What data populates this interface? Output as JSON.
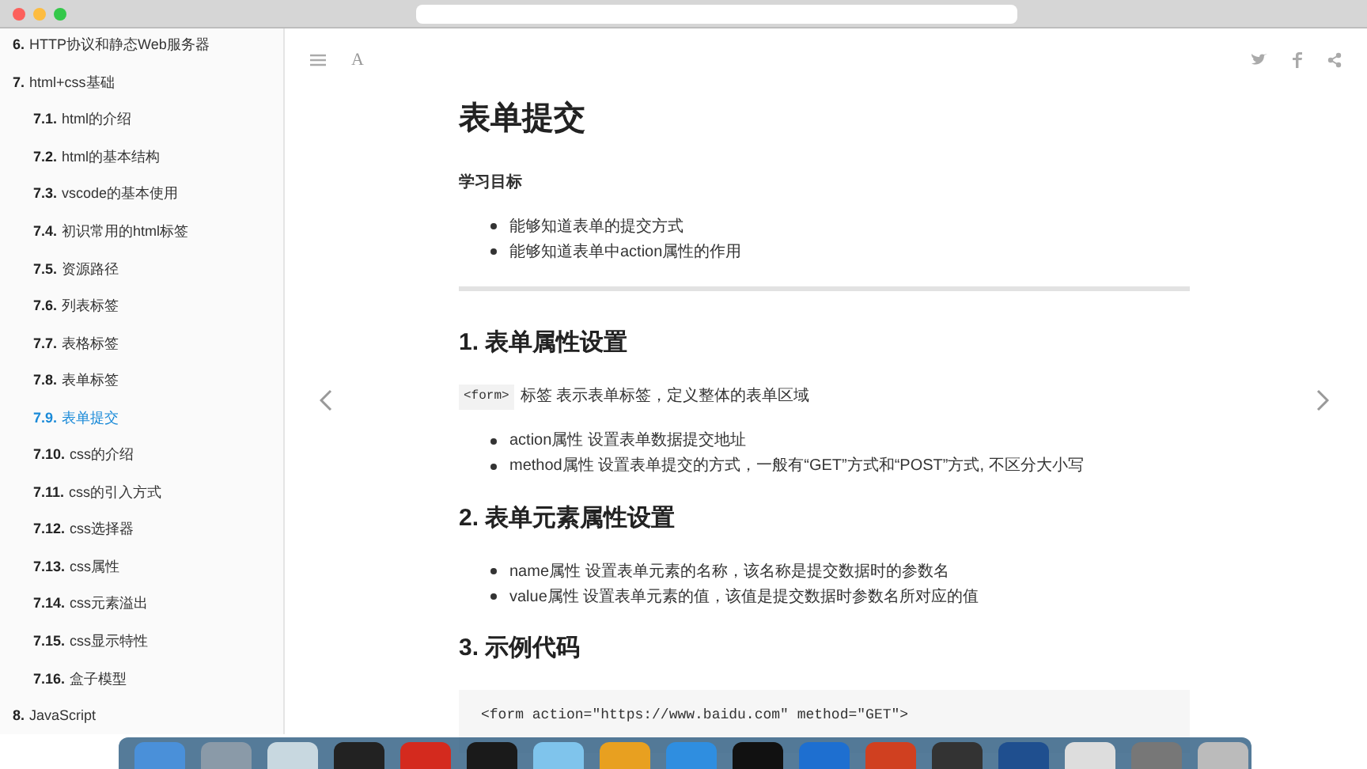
{
  "sidebar": {
    "items": [
      {
        "number": "6.",
        "label": "HTTP协议和静态Web服务器",
        "selected": false
      },
      {
        "number": "7.",
        "label": "html+css基础",
        "selected": false,
        "children": [
          {
            "number": "7.1.",
            "label": "html的介绍",
            "selected": false
          },
          {
            "number": "7.2.",
            "label": "html的基本结构",
            "selected": false
          },
          {
            "number": "7.3.",
            "label": "vscode的基本使用",
            "selected": false
          },
          {
            "number": "7.4.",
            "label": "初识常用的html标签",
            "selected": false
          },
          {
            "number": "7.5.",
            "label": "资源路径",
            "selected": false
          },
          {
            "number": "7.6.",
            "label": "列表标签",
            "selected": false
          },
          {
            "number": "7.7.",
            "label": "表格标签",
            "selected": false
          },
          {
            "number": "7.8.",
            "label": "表单标签",
            "selected": false
          },
          {
            "number": "7.9.",
            "label": "表单提交",
            "selected": true
          },
          {
            "number": "7.10.",
            "label": "css的介绍",
            "selected": false
          },
          {
            "number": "7.11.",
            "label": "css的引入方式",
            "selected": false
          },
          {
            "number": "7.12.",
            "label": "css选择器",
            "selected": false
          },
          {
            "number": "7.13.",
            "label": "css属性",
            "selected": false
          },
          {
            "number": "7.14.",
            "label": "css元素溢出",
            "selected": false
          },
          {
            "number": "7.15.",
            "label": "css显示特性",
            "selected": false
          },
          {
            "number": "7.16.",
            "label": "盒子模型",
            "selected": false
          }
        ]
      },
      {
        "number": "8.",
        "label": "JavaScript",
        "selected": false
      }
    ]
  },
  "toolbar": {
    "font_button": "A"
  },
  "article": {
    "title": "表单提交",
    "blocks": [
      {
        "kind": "strong",
        "text": "学习目标"
      },
      {
        "kind": "list",
        "items": [
          "能够知道表单的提交方式",
          "能够知道表单中action属性的作用"
        ]
      },
      {
        "kind": "rule"
      },
      {
        "kind": "heading",
        "text": "1. 表单属性设置"
      },
      {
        "kind": "para",
        "code": "<form>",
        "text": "标签 表示表单标签，定义整体的表单区域"
      },
      {
        "kind": "list",
        "items": [
          "action属性 设置表单数据提交地址",
          "method属性 设置表单提交的方式，一般有“GET”方式和“POST”方式, 不区分大小写"
        ]
      },
      {
        "kind": "heading",
        "text": "2. 表单元素属性设置"
      },
      {
        "kind": "list",
        "items": [
          "name属性 设置表单元素的名称，该名称是提交数据时的参数名",
          "value属性 设置表单元素的值，该值是提交数据时参数名所对应的值"
        ]
      },
      {
        "kind": "heading",
        "text": "3. 示例代码"
      },
      {
        "kind": "code",
        "lines": [
          "<form action=\"https://www.baidu.com\" method=\"GET\">"
        ]
      }
    ]
  }
}
